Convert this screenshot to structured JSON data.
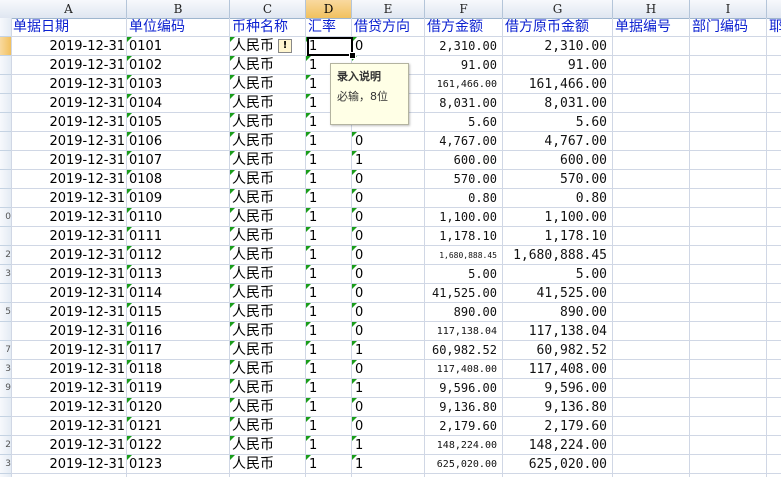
{
  "columns": [
    "A",
    "B",
    "C",
    "D",
    "E",
    "F",
    "G",
    "H",
    "I",
    ""
  ],
  "selected_column": "D",
  "header_row": [
    "单据日期",
    "单位编码",
    "币种名称",
    "汇率",
    "借贷方向",
    "借方金额",
    "借方原币金额",
    "单据编号",
    "部门编码",
    "耶"
  ],
  "row_labels": [
    "",
    "",
    "",
    "",
    "",
    "",
    "",
    "",
    "",
    "0",
    "",
    "2",
    "3",
    "",
    "5",
    "",
    "7",
    "3",
    "9",
    "",
    "",
    "2",
    "3"
  ],
  "rows": [
    {
      "date": "2019-12-31",
      "code": "0101",
      "currency": "人民币",
      "rate": "1",
      "direction": "0",
      "debit": "2,310.00",
      "debit_orig": "2,310.00"
    },
    {
      "date": "2019-12-31",
      "code": "0102",
      "currency": "人民币",
      "rate": "1",
      "direction": "",
      "debit": "91.00",
      "debit_orig": "91.00"
    },
    {
      "date": "2019-12-31",
      "code": "0103",
      "currency": "人民币",
      "rate": "1",
      "direction": "",
      "debit": "161,466.00",
      "debit_orig": "161,466.00"
    },
    {
      "date": "2019-12-31",
      "code": "0104",
      "currency": "人民币",
      "rate": "1",
      "direction": "",
      "debit": "8,031.00",
      "debit_orig": "8,031.00"
    },
    {
      "date": "2019-12-31",
      "code": "0105",
      "currency": "人民币",
      "rate": "1",
      "direction": "",
      "debit": "5.60",
      "debit_orig": "5.60"
    },
    {
      "date": "2019-12-31",
      "code": "0106",
      "currency": "人民币",
      "rate": "1",
      "direction": "0",
      "debit": "4,767.00",
      "debit_orig": "4,767.00"
    },
    {
      "date": "2019-12-31",
      "code": "0107",
      "currency": "人民币",
      "rate": "1",
      "direction": "1",
      "debit": "600.00",
      "debit_orig": "600.00"
    },
    {
      "date": "2019-12-31",
      "code": "0108",
      "currency": "人民币",
      "rate": "1",
      "direction": "0",
      "debit": "570.00",
      "debit_orig": "570.00"
    },
    {
      "date": "2019-12-31",
      "code": "0109",
      "currency": "人民币",
      "rate": "1",
      "direction": "0",
      "debit": "0.80",
      "debit_orig": "0.80"
    },
    {
      "date": "2019-12-31",
      "code": "0110",
      "currency": "人民币",
      "rate": "1",
      "direction": "0",
      "debit": "1,100.00",
      "debit_orig": "1,100.00"
    },
    {
      "date": "2019-12-31",
      "code": "0111",
      "currency": "人民币",
      "rate": "1",
      "direction": "0",
      "debit": "1,178.10",
      "debit_orig": "1,178.10"
    },
    {
      "date": "2019-12-31",
      "code": "0112",
      "currency": "人民币",
      "rate": "1",
      "direction": "0",
      "debit": "1,680,888.45",
      "debit_orig": "1,680,888.45"
    },
    {
      "date": "2019-12-31",
      "code": "0113",
      "currency": "人民币",
      "rate": "1",
      "direction": "0",
      "debit": "5.00",
      "debit_orig": "5.00"
    },
    {
      "date": "2019-12-31",
      "code": "0114",
      "currency": "人民币",
      "rate": "1",
      "direction": "0",
      "debit": "41,525.00",
      "debit_orig": "41,525.00"
    },
    {
      "date": "2019-12-31",
      "code": "0115",
      "currency": "人民币",
      "rate": "1",
      "direction": "0",
      "debit": "890.00",
      "debit_orig": "890.00"
    },
    {
      "date": "2019-12-31",
      "code": "0116",
      "currency": "人民币",
      "rate": "1",
      "direction": "0",
      "debit": "117,138.04",
      "debit_orig": "117,138.04"
    },
    {
      "date": "2019-12-31",
      "code": "0117",
      "currency": "人民币",
      "rate": "1",
      "direction": "1",
      "debit": "60,982.52",
      "debit_orig": "60,982.52"
    },
    {
      "date": "2019-12-31",
      "code": "0118",
      "currency": "人民币",
      "rate": "1",
      "direction": "0",
      "debit": "117,408.00",
      "debit_orig": "117,408.00"
    },
    {
      "date": "2019-12-31",
      "code": "0119",
      "currency": "人民币",
      "rate": "1",
      "direction": "1",
      "debit": "9,596.00",
      "debit_orig": "9,596.00"
    },
    {
      "date": "2019-12-31",
      "code": "0120",
      "currency": "人民币",
      "rate": "1",
      "direction": "0",
      "debit": "9,136.80",
      "debit_orig": "9,136.80"
    },
    {
      "date": "2019-12-31",
      "code": "0121",
      "currency": "人民币",
      "rate": "1",
      "direction": "0",
      "debit": "2,179.60",
      "debit_orig": "2,179.60"
    },
    {
      "date": "2019-12-31",
      "code": "0122",
      "currency": "人民币",
      "rate": "1",
      "direction": "1",
      "debit": "148,224.00",
      "debit_orig": "148,224.00"
    },
    {
      "date": "2019-12-31",
      "code": "0123",
      "currency": "人民币",
      "rate": "1",
      "direction": "1",
      "debit": "625,020.00",
      "debit_orig": "625,020.00"
    }
  ],
  "tooltip": {
    "title": "录入说明",
    "body": "必输，8位"
  },
  "warning_icon": {
    "name": "warning-diamond-icon",
    "glyph": "!"
  },
  "colors": {
    "header_text": "#0a1fd0",
    "comment_triangle": "#1a9d1a",
    "selected_header": "#f1c15f"
  }
}
